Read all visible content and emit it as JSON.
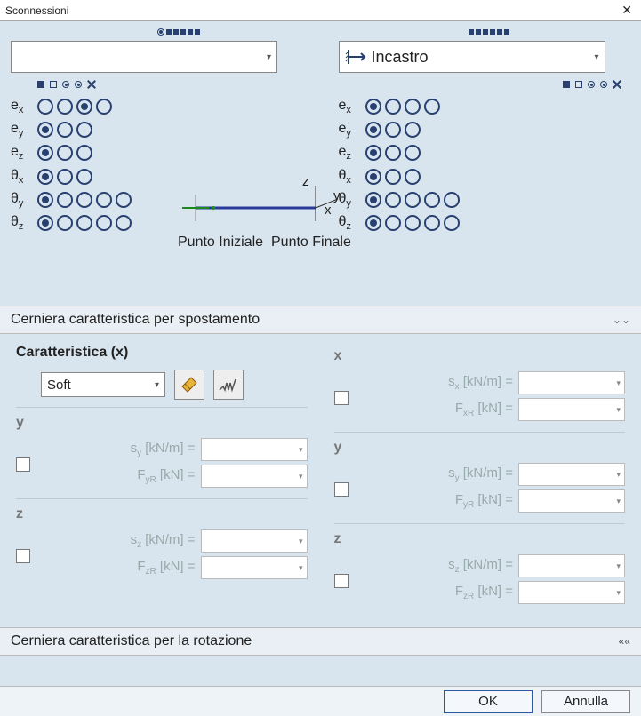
{
  "window": {
    "title": "Sconnessioni",
    "close": "✕"
  },
  "top_legend": {
    "dots": [
      "■",
      "■",
      "■",
      "■",
      "■",
      "■"
    ]
  },
  "left": {
    "select_value": "",
    "dof": {
      "e_x": {
        "label_main": "e",
        "label_sub": "x",
        "count": 4,
        "selected": 2,
        "extra": false
      },
      "e_y": {
        "label_main": "e",
        "label_sub": "y",
        "count": 3,
        "selected": 0,
        "extra": false
      },
      "e_z": {
        "label_main": "e",
        "label_sub": "z",
        "count": 3,
        "selected": 0,
        "extra": false
      },
      "t_x": {
        "label_main": "θ",
        "label_sub": "x",
        "count": 3,
        "selected": 0,
        "extra": false
      },
      "t_y": {
        "label_main": "θ",
        "label_sub": "y",
        "count": 5,
        "selected": 0,
        "extra": true
      },
      "t_z": {
        "label_main": "θ",
        "label_sub": "z",
        "count": 5,
        "selected": 0,
        "extra": true
      }
    }
  },
  "right": {
    "select_value": "Incastro",
    "dof": {
      "e_x": {
        "label_main": "e",
        "label_sub": "x",
        "count": 4,
        "selected": 0,
        "extra": false
      },
      "e_y": {
        "label_main": "e",
        "label_sub": "y",
        "count": 3,
        "selected": 0,
        "extra": false
      },
      "e_z": {
        "label_main": "e",
        "label_sub": "z",
        "count": 3,
        "selected": 0,
        "extra": false
      },
      "t_x": {
        "label_main": "θ",
        "label_sub": "x",
        "count": 3,
        "selected": 0,
        "extra": false
      },
      "t_y": {
        "label_main": "θ",
        "label_sub": "y",
        "count": 5,
        "selected": 0,
        "extra": true
      },
      "t_z": {
        "label_main": "θ",
        "label_sub": "z",
        "count": 5,
        "selected": 0,
        "extra": true
      }
    }
  },
  "diagram": {
    "z": "z",
    "y": "y",
    "x": "x",
    "pi": "Punto Iniziale",
    "pf": "Punto Finale"
  },
  "section1": {
    "title": "Cerniera caratteristica per spostamento",
    "char_title": "Caratteristica (x)",
    "soft": "Soft",
    "cols": {
      "x": {
        "head": "x",
        "s_lbl": "s",
        "s_sub": "x",
        "s_unit": " [kN/m] =",
        "F_lbl": "F",
        "F_sub": "xR",
        "F_unit": " [kN] ="
      },
      "y": {
        "head": "y",
        "s_lbl": "s",
        "s_sub": "y",
        "s_unit": " [kN/m] =",
        "F_lbl": "F",
        "F_sub": "yR",
        "F_unit": " [kN] ="
      },
      "y2": {
        "head": "y",
        "s_lbl": "s",
        "s_sub": "y",
        "s_unit": " [kN/m] =",
        "F_lbl": "F",
        "F_sub": "yR",
        "F_unit": " [kN] ="
      },
      "z": {
        "head": "z",
        "s_lbl": "s",
        "s_sub": "z",
        "s_unit": " [kN/m] =",
        "F_lbl": "F",
        "F_sub": "zR",
        "F_unit": " [kN] ="
      },
      "z2": {
        "head": "z",
        "s_lbl": "s",
        "s_sub": "z",
        "s_unit": " [kN/m] =",
        "F_lbl": "F",
        "F_sub": "zR",
        "F_unit": " [kN] ="
      }
    }
  },
  "section2": {
    "title": "Cerniera caratteristica per la rotazione"
  },
  "buttons": {
    "ok": "OK",
    "cancel": "Annulla"
  }
}
